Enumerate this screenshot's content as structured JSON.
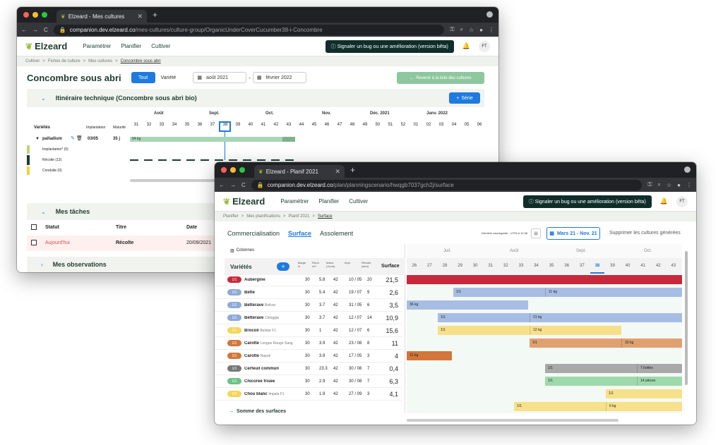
{
  "w1": {
    "tab_title": "Elzeard - Mes cultures",
    "url_host": "companion.dev.elzeard.co",
    "url_path": "/mes-cultures/culture-group/OrganicUnderCoverCucumber38-i-Concombre",
    "nav": [
      "Paramétrer",
      "Planifier",
      "Cultiver"
    ],
    "bug_button": "Signaler un bug ou une amélioration (version bêta)",
    "avatar": "FT",
    "breadcrumb": [
      "Cultiver",
      ">",
      "Fiches de culture",
      ">",
      "Mes cultures",
      ">"
    ],
    "breadcrumb_current": "Concombre sous abri",
    "page_title": "Concombre sous abri",
    "filter_all": "Tout",
    "filter_variety": "Variété",
    "date_from": "août 2021",
    "date_sep": "-",
    "date_to": "février 2022",
    "back_button": "Revenir à la liste des cultures",
    "itinerary_title": "Itinéraire technique (Concombre sous abri bio)",
    "serie_button": "Série",
    "months": [
      "Août",
      "Sept.",
      "Oct.",
      "Nov.",
      "Déc. 2021",
      "Janv. 2022"
    ],
    "weeks": [
      "31",
      "32",
      "33",
      "34",
      "35",
      "36",
      "37",
      "38",
      "39",
      "40",
      "41",
      "42",
      "43",
      "44",
      "45",
      "46",
      "47",
      "48",
      "49",
      "50",
      "51",
      "52",
      "01",
      "02",
      "03",
      "04",
      "05",
      "06"
    ],
    "col_varieties": "Variétés",
    "col_implantation": "Implantation",
    "col_maturite": "Maturité",
    "variety_name": "palladium",
    "variety_implant": "03/05",
    "variety_maturity": "35 j",
    "variety_bar_label": "94 kg",
    "sub_rows": [
      "Implantation* (0)",
      "Récolte (13)",
      "Conduite (0)"
    ],
    "tasks_title": "Mes tâches",
    "tasks_cols": [
      "Statut",
      "Titre",
      "Date"
    ],
    "task_status": "Aujourd'hui",
    "task_title": "Récolte",
    "task_date": "20/09/2021",
    "observations_title": "Mes observations"
  },
  "w2": {
    "tab_title": "Elzeard - Planif 2021",
    "url_host": "companion.dev.elzeard.co",
    "url_path": "/plan/planningscenario/hwqgb7037gch2j/surface",
    "nav": [
      "Paramétrer",
      "Planifier",
      "Cultiver"
    ],
    "bug_button": "Signaler un bug ou une amélioration (version bêta)",
    "avatar": "FT",
    "breadcrumb": [
      "Planifier",
      ">",
      "Mes planifications",
      ">",
      "Planif 2021",
      ">"
    ],
    "breadcrumb_current": "Surface",
    "tabs": [
      "Commercialisation",
      "Surface",
      "Assolement"
    ],
    "last_save": "Dernière sauvegarde : 17/09 à 12:46",
    "date_range": "Mars 21 - Nov. 21",
    "delete_generated": "Supprimer les cultures générées",
    "columns_button": "Colonnes",
    "varieties_header": "Variétés",
    "col_heads": [
      "Marge",
      "Rend.",
      "Matur.",
      "Impl.",
      "Récolte"
    ],
    "col_subs": [
      "/h",
      "/m²",
      "(Jours)",
      "",
      "(sem)"
    ],
    "surface_header": "Surface",
    "months": [
      "Juil.",
      "Août",
      "Sept.",
      "Oct."
    ],
    "weeks": [
      "26",
      "27",
      "28",
      "29",
      "30",
      "31",
      "32",
      "33",
      "34",
      "35",
      "36",
      "37",
      "38",
      "39",
      "40",
      "41",
      "42",
      "43"
    ],
    "rows": [
      {
        "badge": "1/1",
        "name": "Aubergine",
        "sub": "",
        "m": "30",
        "r": "5.8",
        "mat": "42",
        "impl": "10 / 05",
        "rec": "20",
        "surf": "21,5",
        "color": "#c8283c"
      },
      {
        "badge": "1/1",
        "name": "Bette",
        "sub": "",
        "m": "30",
        "r": "5.4",
        "mat": "42",
        "impl": "19 / 07",
        "rec": "9",
        "surf": "2,6",
        "color": "#8fa9d9"
      },
      {
        "badge": "1/1",
        "name": "Betterave",
        "sub": "Bolivar",
        "m": "30",
        "r": "3.7",
        "mat": "42",
        "impl": "31 / 05",
        "rec": "6",
        "surf": "3,5",
        "color": "#8fa9d9"
      },
      {
        "badge": "1/1",
        "name": "Betterave",
        "sub": "Chioggia",
        "m": "30",
        "r": "3.7",
        "mat": "42",
        "impl": "12 / 07",
        "rec": "14",
        "surf": "10,9",
        "color": "#8fa9d9"
      },
      {
        "badge": "1/1",
        "name": "Brocoli",
        "sub": "Belstar F1",
        "m": "30",
        "r": "1",
        "mat": "42",
        "impl": "12 / 07",
        "rec": "6",
        "surf": "15,6",
        "color": "#f5d55a"
      },
      {
        "badge": "1/1",
        "name": "Carotte",
        "sub": "Longue Rouge Sang",
        "m": "30",
        "r": "3.9",
        "mat": "42",
        "impl": "23 / 08",
        "rec": "8",
        "surf": "11",
        "color": "#d2763a"
      },
      {
        "badge": "1/1",
        "name": "Carotte",
        "sub": "Napoli",
        "m": "30",
        "r": "3.9",
        "mat": "42",
        "impl": "17 / 05",
        "rec": "3",
        "surf": "4",
        "color": "#d2763a"
      },
      {
        "badge": "1/1",
        "name": "Cerfeuil commun",
        "sub": "",
        "m": "30",
        "r": "23.3",
        "mat": "42",
        "impl": "30 / 08",
        "rec": "7",
        "surf": "0,4",
        "color": "#777777"
      },
      {
        "badge": "1/1",
        "name": "Chicorée frisée",
        "sub": "",
        "m": "30",
        "r": "2.9",
        "mat": "42",
        "impl": "30 / 08",
        "rec": "7",
        "surf": "6,3",
        "color": "#6cc285"
      },
      {
        "badge": "1/1",
        "name": "Chou blanc",
        "sub": "Impala F1",
        "m": "30",
        "r": "1.9",
        "mat": "42",
        "impl": "27 / 09",
        "rec": "3",
        "surf": "4,1",
        "color": "#f5d55a"
      }
    ],
    "gantt": [
      {
        "left": "",
        "right": "",
        "color": "#c8283c"
      },
      {
        "left": "1/1",
        "right": "11 kg",
        "color": "#a8bde3"
      },
      {
        "left": "36 kg",
        "right": "",
        "color": "#a8bde3"
      },
      {
        "left": "1/1",
        "right": "21 kg",
        "color": "#a8bde3"
      },
      {
        "left": "1/1",
        "right": "12 kg",
        "color": "#f7e08a"
      },
      {
        "left": "1/1",
        "right": "33 kg",
        "color": "#e0a070"
      },
      {
        "left": "12 kg",
        "right": "",
        "color": "#d2763a"
      },
      {
        "left": "1/1",
        "right": "7 bottes",
        "color": "#a9a9a9"
      },
      {
        "left": "1/1",
        "right": "14 pièces",
        "color": "#9ed9ac"
      },
      {
        "left": "1/1",
        "right": "",
        "color": "#f7e08a"
      },
      {
        "left": "1/1",
        "right": "6 kg",
        "color": "#f7e08a"
      }
    ],
    "sum_surfaces": "Somme des surfaces"
  }
}
